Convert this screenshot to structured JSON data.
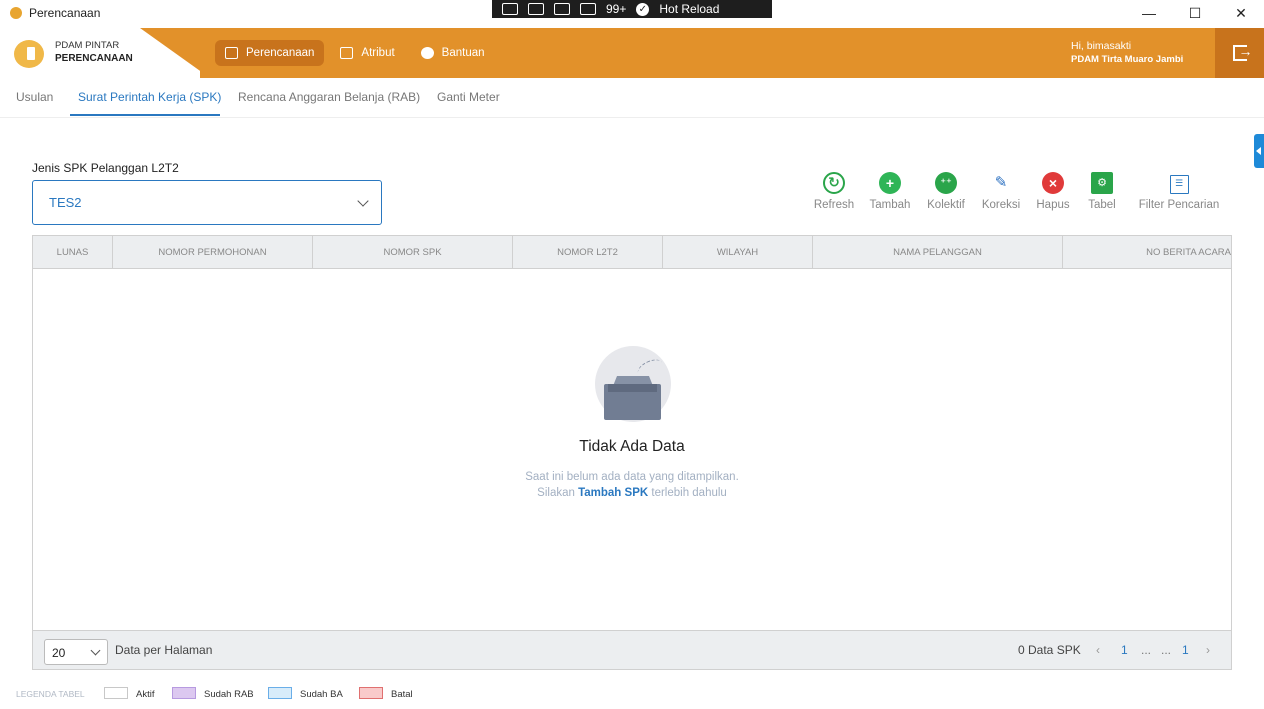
{
  "window": {
    "title": "Perencanaan",
    "controls": {
      "minimize": "—",
      "maximize": "☐",
      "close": "✕"
    }
  },
  "debug_bar": {
    "badge": "99+",
    "hot_reload": "Hot Reload"
  },
  "header": {
    "brand_top": "PDAM PINTAR",
    "brand_bottom": "PERENCANAAN",
    "nav": [
      {
        "label": "Perencanaan",
        "icon": "list-icon",
        "active": true
      },
      {
        "label": "Atribut",
        "icon": "grid-icon",
        "active": false
      },
      {
        "label": "Bantuan",
        "icon": "chat-icon",
        "active": false
      }
    ],
    "greeting": "Hi, bimasakti",
    "organization": "PDAM Tirta Muaro Jambi"
  },
  "tabs": [
    {
      "label": "Usulan",
      "active": false
    },
    {
      "label": "Surat Perintah Kerja (SPK)",
      "active": true
    },
    {
      "label": "Rencana Anggaran Belanja (RAB)",
      "active": false
    },
    {
      "label": "Ganti Meter",
      "active": false
    }
  ],
  "form": {
    "label": "Jenis SPK Pelanggan L2T2",
    "value": "TES2"
  },
  "toolbar": [
    {
      "label": "Refresh",
      "icon": "refresh-icon",
      "color": "#2aa54a"
    },
    {
      "label": "Tambah",
      "icon": "add-icon",
      "color": "#2fb557"
    },
    {
      "label": "Kolektif",
      "icon": "collective-icon",
      "color": "#2aa54a"
    },
    {
      "label": "Koreksi",
      "icon": "edit-icon",
      "color": "#2a6fc0"
    },
    {
      "label": "Hapus",
      "icon": "delete-icon",
      "color": "#e03a3a"
    },
    {
      "label": "Tabel",
      "icon": "table-icon",
      "color": "#2aa54a"
    },
    {
      "label": "Filter Pencarian",
      "icon": "filter-icon",
      "color": "#2a78c0"
    }
  ],
  "table": {
    "columns": [
      "LUNAS",
      "NOMOR PERMOHONAN",
      "NOMOR SPK",
      "NOMOR L2T2",
      "WILAYAH",
      "NAMA PELANGGAN",
      "NO BERITA ACARA"
    ],
    "rows": [],
    "empty_title": "Tidak Ada Data",
    "empty_line1": "Saat ini belum ada data yang ditampilkan.",
    "empty_line2_prefix": "Silakan",
    "empty_link": "Tambah SPK",
    "empty_line2_suffix": "terlebih dahulu"
  },
  "pagination": {
    "page_size": "20",
    "per_page_label": "Data per Halaman",
    "total": "0 Data SPK",
    "prev": "‹",
    "first": "1",
    "ellipsis1": "...",
    "ellipsis2": "...",
    "last": "1",
    "next": "›"
  },
  "legend": {
    "title": "LEGENDA TABEL",
    "items": [
      {
        "label": "Aktif",
        "fill": "#ffffff",
        "border": "#c8c8c8"
      },
      {
        "label": "Sudah RAB",
        "fill": "#dcc8f0",
        "border": "#b79ae0"
      },
      {
        "label": "Sudah BA",
        "fill": "#d8ecfa",
        "border": "#6aaee8"
      },
      {
        "label": "Batal",
        "fill": "#f9caca",
        "border": "#e07070"
      }
    ]
  }
}
